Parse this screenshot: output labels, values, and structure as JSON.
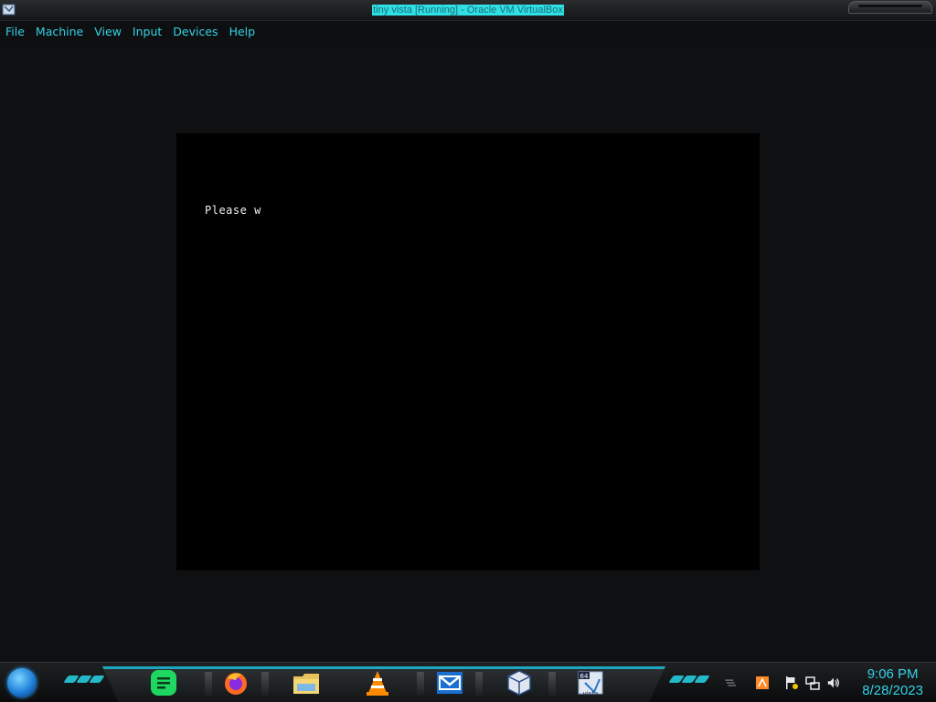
{
  "window": {
    "title": "tiny vista [Running] - Oracle VM VirtualBox",
    "icon": "virtualbox-icon"
  },
  "menu": {
    "items": [
      "File",
      "Machine",
      "View",
      "Input",
      "Devices",
      "Help"
    ]
  },
  "vm": {
    "console_text": "Please w"
  },
  "taskbar": {
    "start": "start-orb-icon",
    "apps": [
      {
        "name": "notes-app-icon"
      },
      {
        "name": "firefox-icon"
      },
      {
        "name": "file-explorer-icon"
      },
      {
        "name": "vlc-icon"
      },
      {
        "name": "mail-icon"
      },
      {
        "name": "virtualbox-icon"
      },
      {
        "name": "vista-64-icon",
        "label": "vista",
        "badge": "64"
      }
    ],
    "tray": [
      {
        "name": "show-desktop-icon"
      },
      {
        "name": "orange-app-icon"
      },
      {
        "name": "action-center-flag-icon"
      },
      {
        "name": "network-icon"
      },
      {
        "name": "volume-icon"
      }
    ],
    "clock": {
      "time": "9:06 PM",
      "date": "8/28/2023"
    }
  },
  "colors": {
    "accent": "#33d2e6",
    "title_highlight": "#2fe0e4"
  }
}
